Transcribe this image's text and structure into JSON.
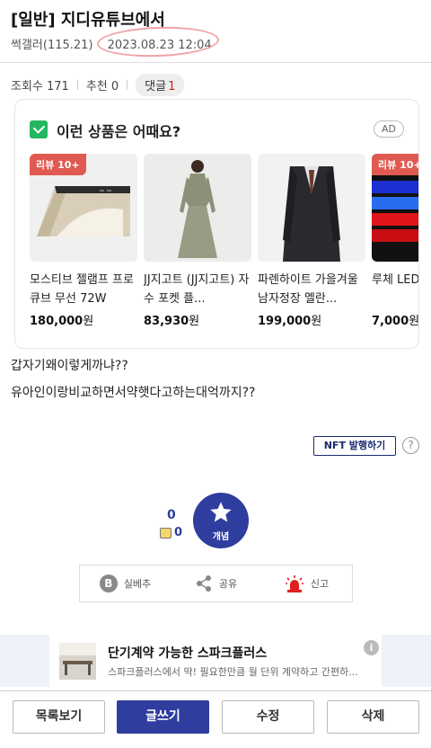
{
  "post": {
    "title": "[일반] 지디유튜브에서",
    "author": "썩갤러(115.21)",
    "date": "2023.08.23 12:04"
  },
  "stats": {
    "views": "조회수 171",
    "recommend": "추천 0",
    "comment_label": "댓글",
    "comment_count": "1"
  },
  "ad": {
    "title": "이런 상품은 어때요?",
    "badge": "AD",
    "products": [
      {
        "badge": "리뷰 10+",
        "name": "모스티브 젤램프 프로 큐브 무선 72W",
        "price": "180,000",
        "unit": "원"
      },
      {
        "badge": "",
        "name": "JJ지고트 (JJ지고트) 자수 포켓 플...",
        "price": "83,930",
        "unit": "원"
      },
      {
        "badge": "",
        "name": "파렌하이트 가을겨울 남자정장 멜란...",
        "price": "199,000",
        "unit": "원"
      },
      {
        "badge": "리뷰 10+",
        "name": "루체 LED 조명 RGB",
        "price": "7,000",
        "unit": "원"
      }
    ]
  },
  "body": {
    "lines": [
      "갑자기왜이렇게까냐??",
      "유아인이랑비교하면서약햇다고하는대억까지??"
    ]
  },
  "nft_button": "NFT 발행하기",
  "help_icon": "?",
  "vote": {
    "count": "0",
    "fix_count": "0",
    "button_label": "개념"
  },
  "actions": {
    "best": "실베추",
    "best_icon": "B",
    "share": "공유",
    "report": "신고"
  },
  "promo": {
    "title": "단기계약 가능한 스파크플러스",
    "desc": "스파크플러스에서 딱! 필요한만큼 월 단위 계약하고 간편하...",
    "info_icon": "i"
  },
  "bottom_nav": {
    "list": "목록보기",
    "write": "글쓰기",
    "edit": "수정",
    "delete": "삭제"
  },
  "colors": {
    "primary": "#2f3d9e",
    "review_badge": "#e05a52",
    "comment_count": "#d31a1a",
    "report": "#e02020"
  }
}
